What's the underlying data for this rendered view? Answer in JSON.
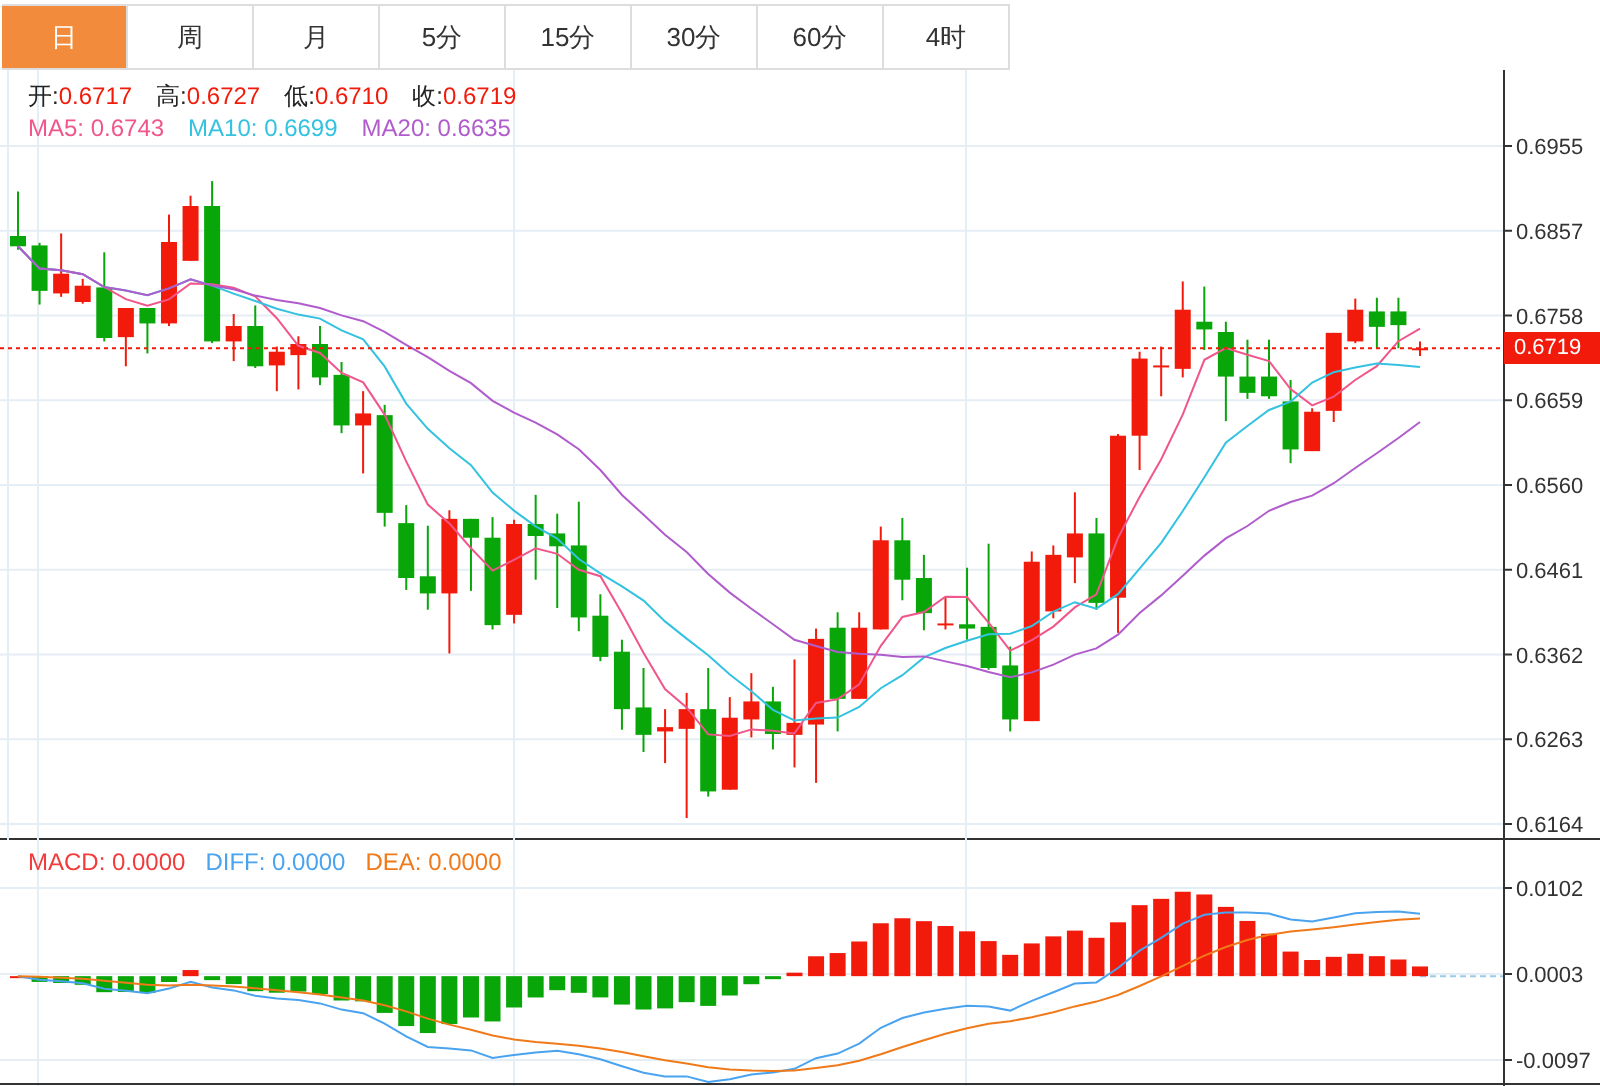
{
  "tabs": [
    {
      "label": "日",
      "selected": true
    },
    {
      "label": "周",
      "selected": false
    },
    {
      "label": "月",
      "selected": false
    },
    {
      "label": "5分",
      "selected": false
    },
    {
      "label": "15分",
      "selected": false
    },
    {
      "label": "30分",
      "selected": false
    },
    {
      "label": "60分",
      "selected": false
    },
    {
      "label": "4时",
      "selected": false
    }
  ],
  "main_chart": {
    "ohlc": [
      {
        "label": "开:",
        "value": "0.6717"
      },
      {
        "label": "高:",
        "value": "0.6727"
      },
      {
        "label": "低:",
        "value": "0.6710"
      },
      {
        "label": "收:",
        "value": "0.6719"
      }
    ],
    "ma_legend": [
      {
        "label": "MA5: 0.6743",
        "color": "#f0568b"
      },
      {
        "label": "MA10: 0.6699",
        "color": "#33c2e0"
      },
      {
        "label": "MA20: 0.6635",
        "color": "#b05ccc"
      }
    ],
    "price_axis": [
      "0.6955",
      "0.6857",
      "0.6758",
      "0.6659",
      "0.6560",
      "0.6461",
      "0.6362",
      "0.6263",
      "0.6164"
    ],
    "price_tag": "0.6719"
  },
  "macd_panel": {
    "legend": [
      {
        "label": "MACD: 0.0000",
        "color": "#f23b3b"
      },
      {
        "label": "DIFF: 0.0000",
        "color": "#4aa3ef"
      },
      {
        "label": "DEA: 0.0000",
        "color": "#f07a1a"
      }
    ],
    "axis": [
      "0.0102",
      "0.0003",
      "-0.0097"
    ]
  }
}
